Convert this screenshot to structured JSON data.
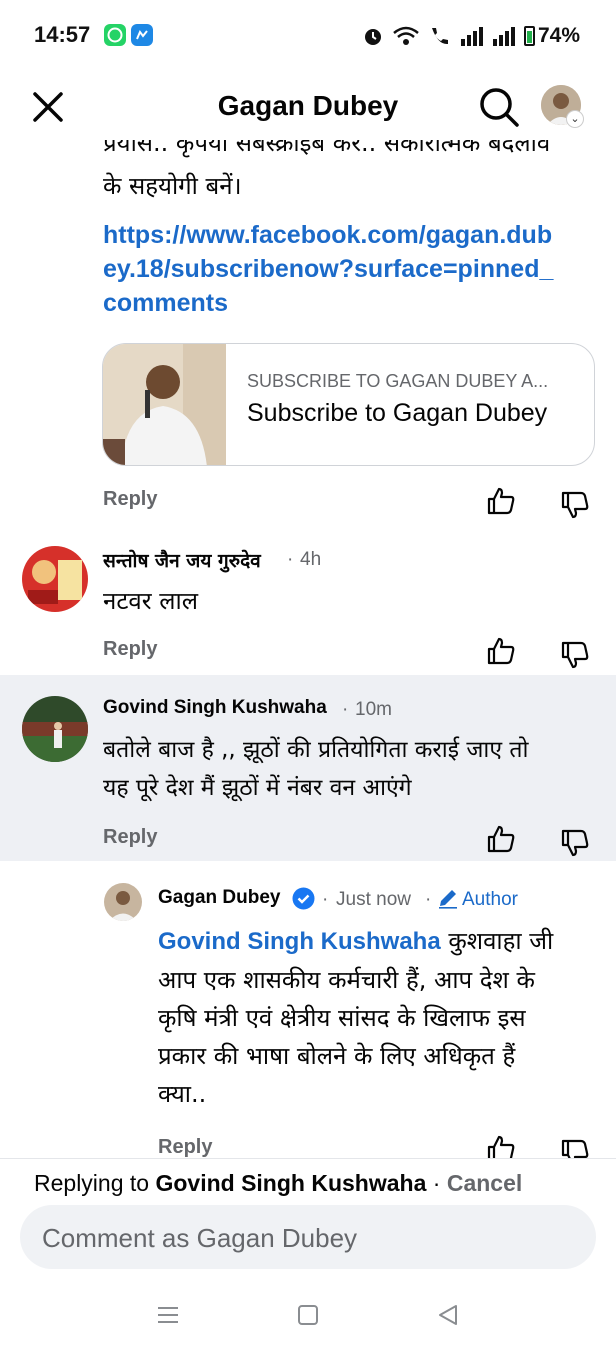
{
  "status_bar": {
    "time": "14:57",
    "battery": "74%",
    "icons": [
      "whatsapp-icon",
      "messenger-icon",
      "alarm-icon",
      "wifi-icon",
      "call-icon",
      "signal-icon",
      "signal-icon",
      "battery-icon"
    ]
  },
  "header": {
    "title": "Gagan Dubey",
    "close_icon": "close-icon",
    "search_icon": "search-icon"
  },
  "post": {
    "text_line1": "प्रयास.. कृपया सबस्क्राइब करें.. सकारात्मक बदलाव",
    "text_line2": "के सहयोगी बनें।",
    "link": "https://www.facebook.com/gagan.dubey.18/subscribenow?surface=pinned_comments",
    "card": {
      "eyebrow": "SUBSCRIBE TO GAGAN DUBEY A...",
      "title": "Subscribe to Gagan Dubey"
    },
    "reply_label": "Reply"
  },
  "comments": [
    {
      "author": "सन्तोष जैन जय गुरुदेव",
      "time": "4h",
      "text": "नटवर लाल",
      "reply_label": "Reply"
    },
    {
      "author": "Govind Singh Kushwaha",
      "time": "10m",
      "text_line1": "बतोले बाज है ,, झूठों की प्रतियोगिता कराई जाए तो",
      "text_line2": "यह पूरे  देश मैं झूठों में नंबर वन आएंगे",
      "reply_label": "Reply"
    }
  ],
  "reply_comment": {
    "author": "Gagan Dubey",
    "time": "Just now",
    "badge": "Author",
    "mention": "Govind Singh Kushwaha",
    "text_line1_rest": " कुशवाहा जी",
    "text_line2": "आप एक शासकीय कर्मचारी हैं, आप देश के",
    "text_line3": "कृषि मंत्री एवं क्षेत्रीय सांसद के खिलाफ इस",
    "text_line4": "प्रकार की भाषा बोलने के लिए अधिकृत हैं",
    "text_line5": "क्या..",
    "reply_label": "Reply"
  },
  "composer": {
    "replying_prefix": "Replying to",
    "replying_to": "Govind Singh Kushwaha",
    "separator": " · ",
    "cancel": "Cancel",
    "placeholder": "Comment as Gagan Dubey"
  },
  "nav_bar": {
    "icons": [
      "menu-icon",
      "home-icon",
      "back-icon"
    ]
  }
}
